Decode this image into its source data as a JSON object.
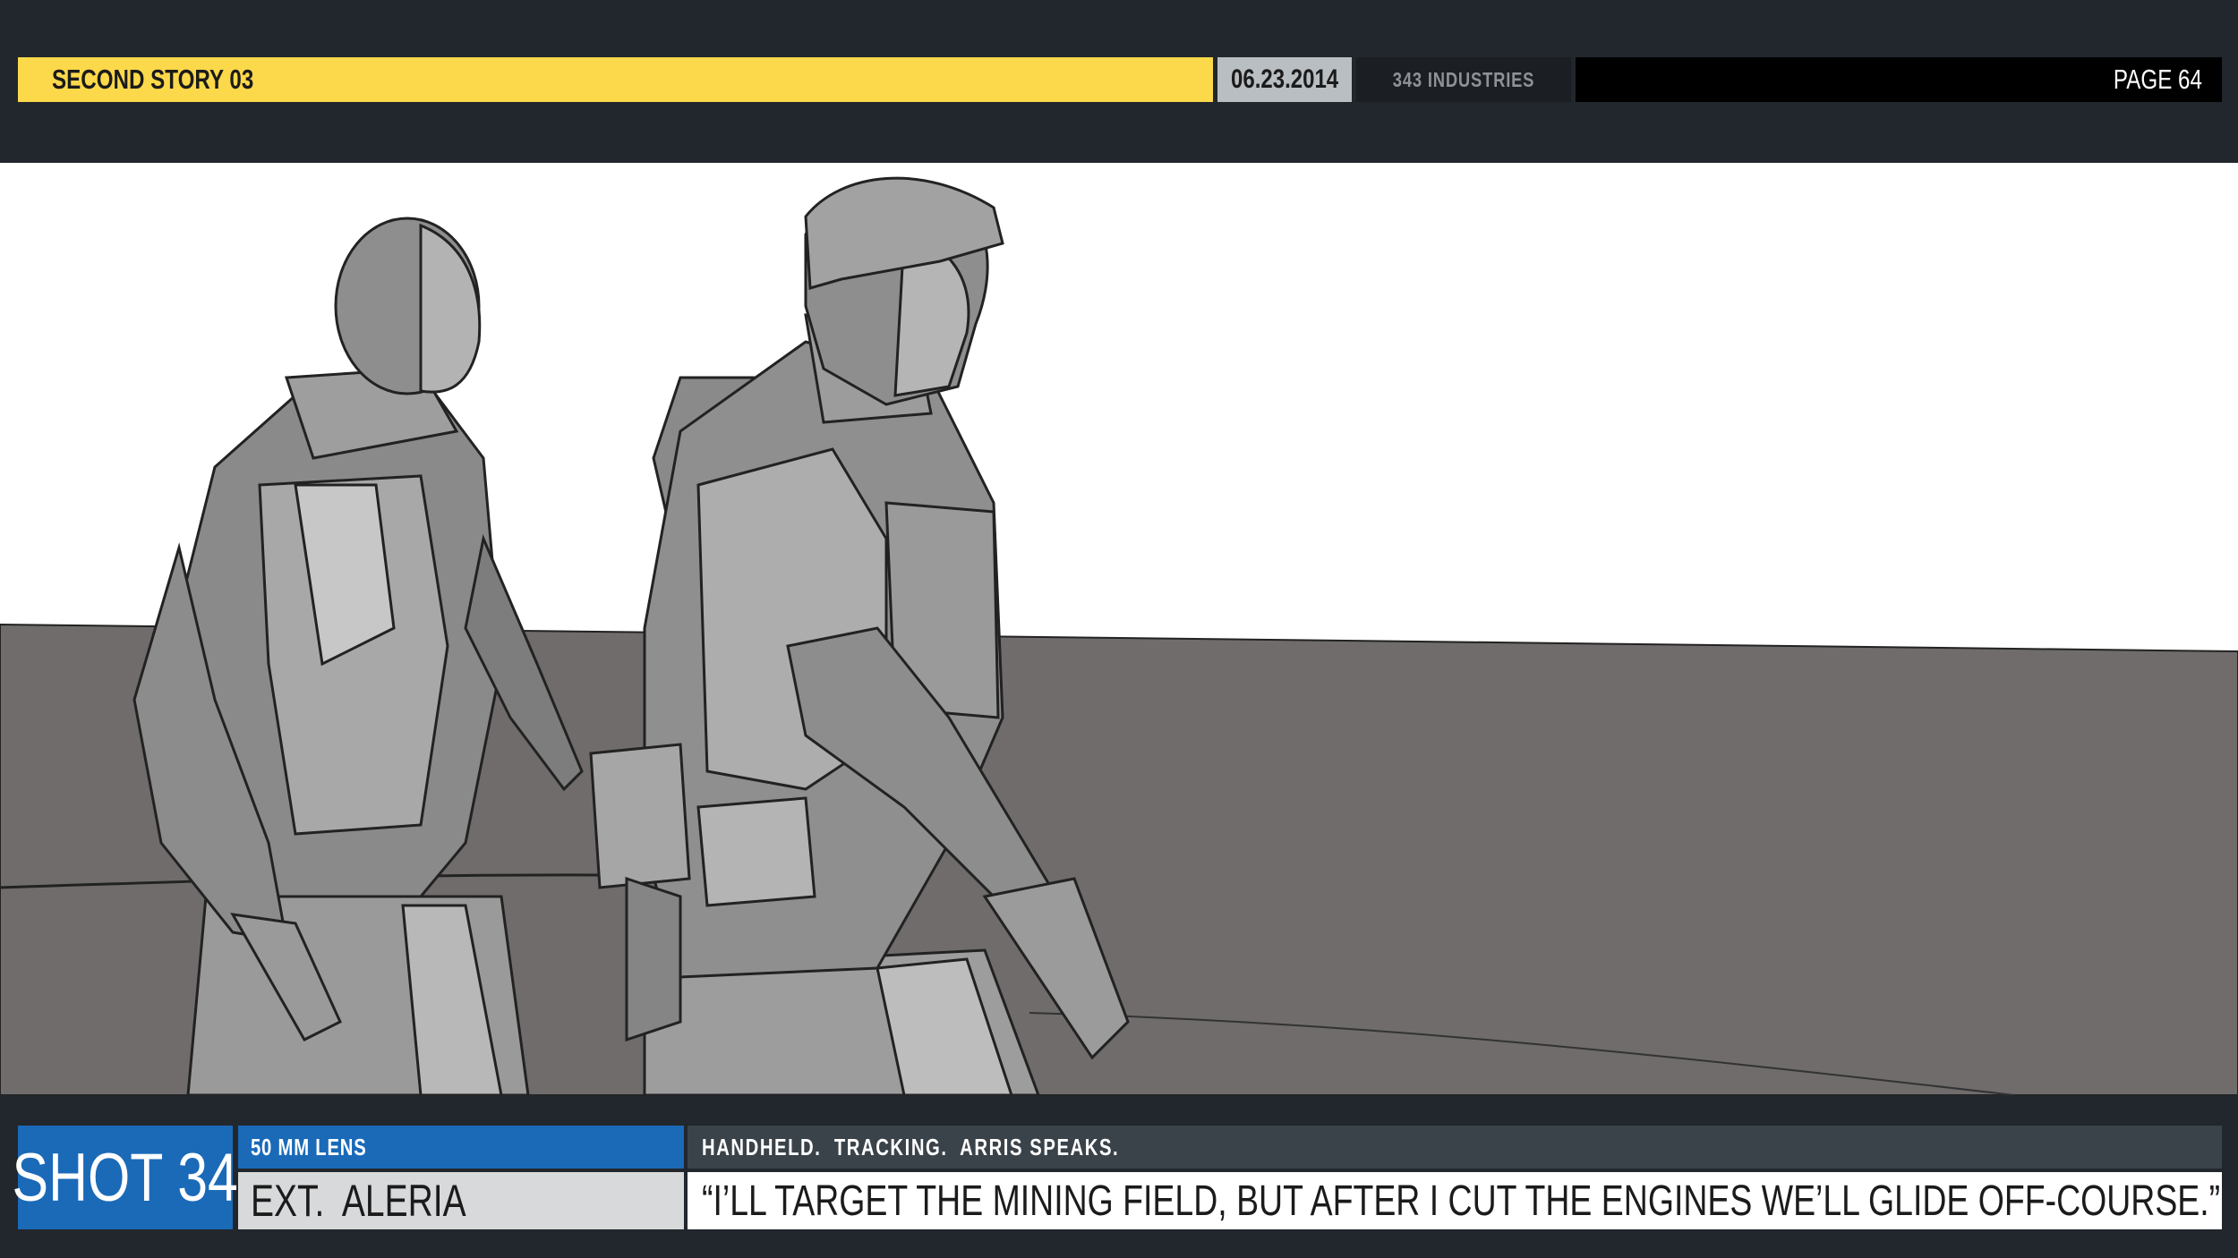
{
  "header": {
    "title": "SECOND STORY 03",
    "date": "06.23.2014",
    "company": "343 INDUSTRIES",
    "page": "PAGE 64"
  },
  "panel": {
    "image_description": "storyboard-frame-two-soldiers-walking"
  },
  "footer": {
    "shot": "SHOT 34",
    "lens": "50 MM LENS",
    "location": "EXT.  ALERIA",
    "camera_notes": "HANDHELD.  TRACKING.  ARRIS SPEAKS.",
    "dialogue": "“I’LL TARGET THE MINING FIELD, BUT AFTER I CUT THE ENGINES WE’LL GLIDE OFF-COURSE.”"
  },
  "colors": {
    "background": "#22272d",
    "title_bar": "#fcd94a",
    "date_bar": "#b9bec2",
    "shot_blue": "#1a6ab8",
    "ground": "#6f6c6b"
  }
}
